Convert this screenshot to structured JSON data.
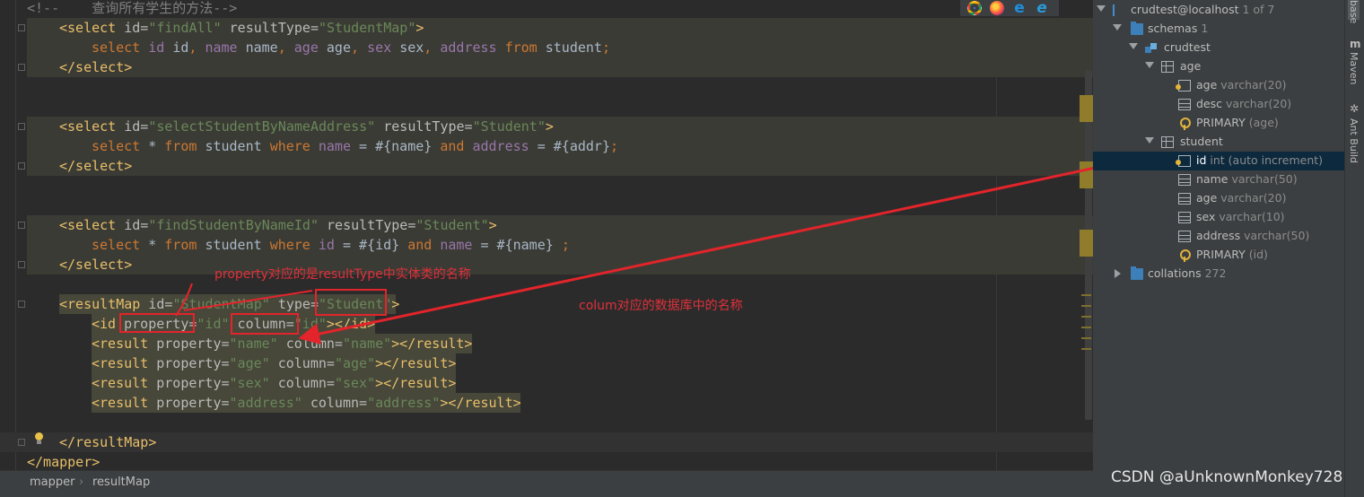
{
  "editor": {
    "lines": [
      {
        "segments": [
          {
            "c": "t-cmt",
            "t": "<!--    查询所有学生的方法-->"
          }
        ]
      },
      {
        "segments": [
          {
            "c": "t-tag",
            "t": "<select "
          },
          {
            "c": "t-attr",
            "t": "id="
          },
          {
            "c": "t-val",
            "t": "\"findAll\""
          },
          {
            "c": "t-attr",
            "t": " resultType="
          },
          {
            "c": "t-val",
            "t": "\"StudentMap\""
          },
          {
            "c": "t-tag",
            "t": ">"
          }
        ]
      },
      {
        "segments": [
          {
            "c": "t-kw",
            "t": "select "
          },
          {
            "c": "t-col",
            "t": "id "
          },
          {
            "c": "t-id",
            "t": "id"
          },
          {
            "c": "t-kw",
            "t": ", "
          },
          {
            "c": "t-col",
            "t": "name "
          },
          {
            "c": "t-id",
            "t": "name"
          },
          {
            "c": "t-kw",
            "t": ", "
          },
          {
            "c": "t-col",
            "t": "age "
          },
          {
            "c": "t-id",
            "t": "age"
          },
          {
            "c": "t-kw",
            "t": ", "
          },
          {
            "c": "t-col",
            "t": "sex "
          },
          {
            "c": "t-id",
            "t": "sex"
          },
          {
            "c": "t-kw",
            "t": ", "
          },
          {
            "c": "t-col",
            "t": "address "
          },
          {
            "c": "t-kw",
            "t": "from "
          },
          {
            "c": "t-id",
            "t": "student"
          },
          {
            "c": "t-kw",
            "t": ";"
          }
        ]
      },
      {
        "segments": [
          {
            "c": "t-tag",
            "t": "</select>"
          }
        ]
      },
      {
        "segments": []
      },
      {
        "segments": []
      },
      {
        "segments": [
          {
            "c": "t-tag",
            "t": "<select "
          },
          {
            "c": "t-attr",
            "t": "id="
          },
          {
            "c": "t-val",
            "t": "\"selectStudentByNameAddress\""
          },
          {
            "c": "t-attr",
            "t": " resultType="
          },
          {
            "c": "t-val",
            "t": "\"Student\""
          },
          {
            "c": "t-tag",
            "t": ">"
          }
        ]
      },
      {
        "segments": [
          {
            "c": "t-kw",
            "t": "select "
          },
          {
            "c": "t-id",
            "t": "* "
          },
          {
            "c": "t-kw",
            "t": "from "
          },
          {
            "c": "t-id",
            "t": "student "
          },
          {
            "c": "t-kw",
            "t": "where "
          },
          {
            "c": "t-col",
            "t": "name "
          },
          {
            "c": "t-id",
            "t": "= #{name} "
          },
          {
            "c": "t-kw",
            "t": "and "
          },
          {
            "c": "t-col",
            "t": "address "
          },
          {
            "c": "t-id",
            "t": "= #{addr}"
          },
          {
            "c": "t-kw",
            "t": ";"
          }
        ]
      },
      {
        "segments": [
          {
            "c": "t-tag",
            "t": "</select>"
          }
        ]
      },
      {
        "segments": []
      },
      {
        "segments": []
      },
      {
        "segments": [
          {
            "c": "t-tag",
            "t": "<select "
          },
          {
            "c": "t-attr",
            "t": "id="
          },
          {
            "c": "t-val",
            "t": "\"findStudentByNameId\""
          },
          {
            "c": "t-attr",
            "t": " resultType="
          },
          {
            "c": "t-val",
            "t": "\"Student\""
          },
          {
            "c": "t-tag",
            "t": ">"
          }
        ]
      },
      {
        "segments": [
          {
            "c": "t-kw",
            "t": "select "
          },
          {
            "c": "t-id",
            "t": "* "
          },
          {
            "c": "t-kw",
            "t": "from "
          },
          {
            "c": "t-id",
            "t": "student "
          },
          {
            "c": "t-kw",
            "t": "where "
          },
          {
            "c": "t-col",
            "t": "id "
          },
          {
            "c": "t-id",
            "t": "= #{id} "
          },
          {
            "c": "t-kw",
            "t": "and "
          },
          {
            "c": "t-col",
            "t": "name "
          },
          {
            "c": "t-id",
            "t": "= #{name} "
          },
          {
            "c": "t-kw",
            "t": ";"
          }
        ]
      },
      {
        "segments": [
          {
            "c": "t-tag",
            "t": "</select>"
          }
        ]
      },
      {
        "segments": []
      },
      {
        "segments": [
          {
            "c": "t-tag",
            "t": "<resultMap "
          },
          {
            "c": "t-attr",
            "t": "id="
          },
          {
            "c": "t-val",
            "t": "\"StudentMap\""
          },
          {
            "c": "t-attr",
            "t": " type="
          },
          {
            "c": "t-val",
            "t": "\"Student\""
          },
          {
            "c": "t-tag",
            "t": ">"
          }
        ]
      },
      {
        "segments": [
          {
            "c": "t-tag",
            "t": "<id "
          },
          {
            "c": "t-attr",
            "t": "property="
          },
          {
            "c": "t-val",
            "t": "\"id\""
          },
          {
            "c": "t-attr",
            "t": " column="
          },
          {
            "c": "t-val",
            "t": "\"id\""
          },
          {
            "c": "t-tag",
            "t": "></id>"
          }
        ]
      },
      {
        "segments": [
          {
            "c": "t-tag",
            "t": "<result "
          },
          {
            "c": "t-attr",
            "t": "property="
          },
          {
            "c": "t-val",
            "t": "\"name\""
          },
          {
            "c": "t-attr",
            "t": " column="
          },
          {
            "c": "t-val",
            "t": "\"name\""
          },
          {
            "c": "t-tag",
            "t": "></result>"
          }
        ]
      },
      {
        "segments": [
          {
            "c": "t-tag",
            "t": "<result "
          },
          {
            "c": "t-attr",
            "t": "property="
          },
          {
            "c": "t-val",
            "t": "\"age\""
          },
          {
            "c": "t-attr",
            "t": " column="
          },
          {
            "c": "t-val",
            "t": "\"age\""
          },
          {
            "c": "t-tag",
            "t": "></result>"
          }
        ]
      },
      {
        "segments": [
          {
            "c": "t-tag",
            "t": "<result "
          },
          {
            "c": "t-attr",
            "t": "property="
          },
          {
            "c": "t-val",
            "t": "\"sex\""
          },
          {
            "c": "t-attr",
            "t": " column="
          },
          {
            "c": "t-val",
            "t": "\"sex\""
          },
          {
            "c": "t-tag",
            "t": "></result>"
          }
        ]
      },
      {
        "segments": [
          {
            "c": "t-tag",
            "t": "<result "
          },
          {
            "c": "t-attr",
            "t": "property="
          },
          {
            "c": "t-val",
            "t": "\"address\""
          },
          {
            "c": "t-attr",
            "t": " column="
          },
          {
            "c": "t-val",
            "t": "\"address\""
          },
          {
            "c": "t-tag",
            "t": "></result>"
          }
        ]
      },
      {
        "segments": []
      },
      {
        "segments": [
          {
            "c": "t-tag",
            "t": "</resultMap>"
          }
        ]
      },
      {
        "segments": [
          {
            "c": "t-tag",
            "t": "</mapper>"
          }
        ]
      }
    ]
  },
  "annotations": {
    "property_note": "property对应的是resultType中实体类的名称",
    "column_note": "colum对应的数据库中的名称"
  },
  "browser_icons": [
    "chrome-icon",
    "firefox-icon",
    "edge-icon",
    "ie-icon"
  ],
  "breadcrumb": {
    "items": [
      "mapper",
      "resultMap"
    ]
  },
  "database": {
    "connection": {
      "label": "crudtest@localhost",
      "meta": "1 of 7"
    },
    "schemas": {
      "label": "schemas",
      "meta": "1"
    },
    "schema": {
      "label": "crudtest"
    },
    "table_age": {
      "label": "age",
      "columns": [
        {
          "name": "age",
          "type": "varchar(20)",
          "icon": "key-column-icon"
        },
        {
          "name": "desc",
          "type": "varchar(20)",
          "icon": "column-icon"
        },
        {
          "name": "PRIMARY",
          "type": "(age)",
          "icon": "primary-key-icon"
        }
      ]
    },
    "table_student": {
      "label": "student",
      "columns": [
        {
          "name": "id",
          "type": "int (auto increment)",
          "icon": "key-column-icon"
        },
        {
          "name": "name",
          "type": "varchar(50)",
          "icon": "column-icon"
        },
        {
          "name": "age",
          "type": "varchar(20)",
          "icon": "column-icon"
        },
        {
          "name": "sex",
          "type": "varchar(10)",
          "icon": "column-icon"
        },
        {
          "name": "address",
          "type": "varchar(50)",
          "icon": "column-icon"
        },
        {
          "name": "PRIMARY",
          "type": "(id)",
          "icon": "primary-key-icon"
        }
      ]
    },
    "collations": {
      "label": "collations",
      "meta": "272"
    }
  },
  "tool_windows": {
    "database": "base",
    "maven": "Maven",
    "ant": "Ant Build"
  },
  "watermark": "CSDN @aUnknownMonkey728",
  "colors": {
    "annotation": "#e3242b",
    "selection": "#0d293e"
  }
}
